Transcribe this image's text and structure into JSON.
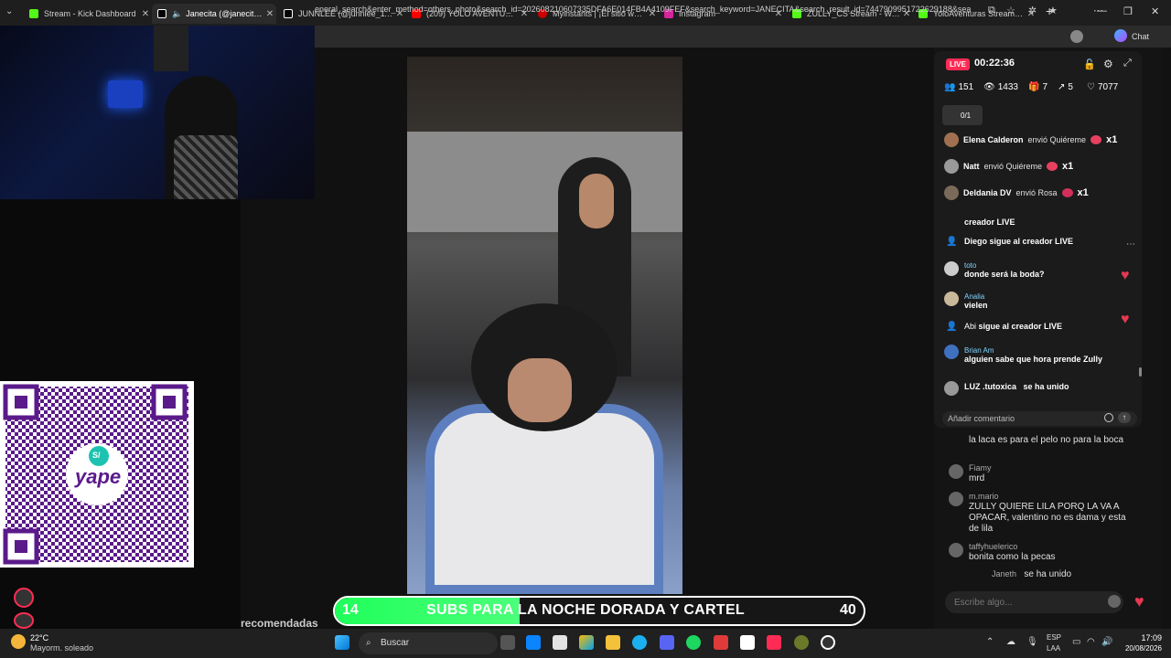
{
  "tabs": [
    {
      "label": "Stream - Kick Dashboard",
      "color": "#53fc18"
    },
    {
      "label": "Janecita (@janecitatiktok)",
      "color": "#ffffff",
      "active": true
    },
    {
      "label": "JUNNLEE (@junnlee_11.11)",
      "color": "#ffffff"
    },
    {
      "label": "(209) YOLO AVENTURAS - Yo",
      "color": "#ff0000"
    },
    {
      "label": "Myinstants | ¡El sitio web de",
      "color": "#cc0000"
    },
    {
      "label": "Instagram",
      "color": "#d6249f"
    },
    {
      "label": "ZULLY_CS Stream - Watch",
      "color": "#53fc18"
    },
    {
      "label": "YoloAventuras Stream - Wat",
      "color": "#53fc18"
    }
  ],
  "url": "eneral_search&enter_method=others_photo&search_id=202608210607335DFA6E014FB4A4109FEF&search_keyword=JANECITA&search_result_id=7447909951722629188&sea",
  "chat_button": "Chat",
  "live": {
    "badge": "LIVE",
    "timer": "00:22:36",
    "stats": {
      "viewers": "151",
      "views": "1433",
      "gifts": "7",
      "shares": "5",
      "likes": "7077"
    },
    "rank": "0/1"
  },
  "gifts": [
    {
      "user": "Elena Calderon",
      "action": "envió Quiéreme",
      "mult": "x1"
    },
    {
      "user": "Natt",
      "action": "envió Quiéreme",
      "mult": "x1"
    },
    {
      "user": "Deldania DV",
      "action": "envió Rosa",
      "mult": "x1"
    }
  ],
  "chat_messages": [
    {
      "user": "",
      "text": "creador LIVE"
    },
    {
      "user": "Diego",
      "text": "sigue al creador LIVE"
    },
    {
      "user": "toto",
      "text": "donde será la boda?"
    },
    {
      "user": "Analia",
      "text": "vielen"
    },
    {
      "user": "Abi",
      "text": "sigue al creador LIVE"
    },
    {
      "user": "Brian Am",
      "text": "alguien sabe que hora prende Zully"
    },
    {
      "user": "LUZ .tutoxica",
      "text": "se ha unido"
    }
  ],
  "add_comment_placeholder": "Añadir comentario",
  "lower_chat": [
    {
      "user": "",
      "text": "la laca es para el pelo no para la boca"
    },
    {
      "user": "Fiamy",
      "text": "mrd"
    },
    {
      "user": "m.mario",
      "text": "ZULLY QUIERE LILA PORQ LA VA A OPACAR, valentino no es dama y esta de lila"
    },
    {
      "user": "taffyhuelerico",
      "text": "bonita como la pecas"
    },
    {
      "user": "Janeth",
      "text": "se ha unido"
    }
  ],
  "escribe_placeholder": "Escribe algo...",
  "banner": {
    "left": "14",
    "text": "SUBS PARA LA NOCHE DORADA Y CARTEL",
    "right": "40",
    "progress": 0.35
  },
  "recomendadas": "recomendadas",
  "taskbar": {
    "temp": "22°C",
    "weather": "Mayorm. soleado",
    "search": "Buscar",
    "lang": "ESP",
    "region": "LAA",
    "time": "17:09",
    "date": "20/08/2026"
  },
  "qr": {
    "brand": "yape",
    "symbol": "S/"
  }
}
